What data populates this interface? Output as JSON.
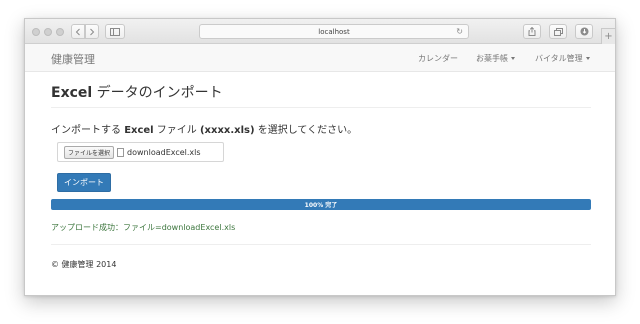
{
  "browser": {
    "url": "localhost"
  },
  "navbar": {
    "brand": "健康管理",
    "items": [
      {
        "label": "カレンダー",
        "dropdown": false
      },
      {
        "label": "お薬手帳",
        "dropdown": true
      },
      {
        "label": "バイタル管理",
        "dropdown": true
      }
    ]
  },
  "page": {
    "title_bold": "Excel",
    "title_rest": " データのインポート",
    "instruction_pre": "インポートする ",
    "instruction_bold1": "Excel",
    "instruction_mid": " ファイル ",
    "instruction_bold2": "(xxxx.xls)",
    "instruction_post": " を選択してください。",
    "file_button": "ファイルを選択",
    "file_name": "downloadExcel.xls",
    "import_button": "インポート",
    "progress_label": "100% 完了",
    "progress_percent": 100,
    "success_message": "アップロード成功：ファイル=downloadExcel.xls",
    "footer": "© 健康管理 2014"
  },
  "colors": {
    "primary": "#337ab7",
    "success_text": "#3c763d"
  }
}
